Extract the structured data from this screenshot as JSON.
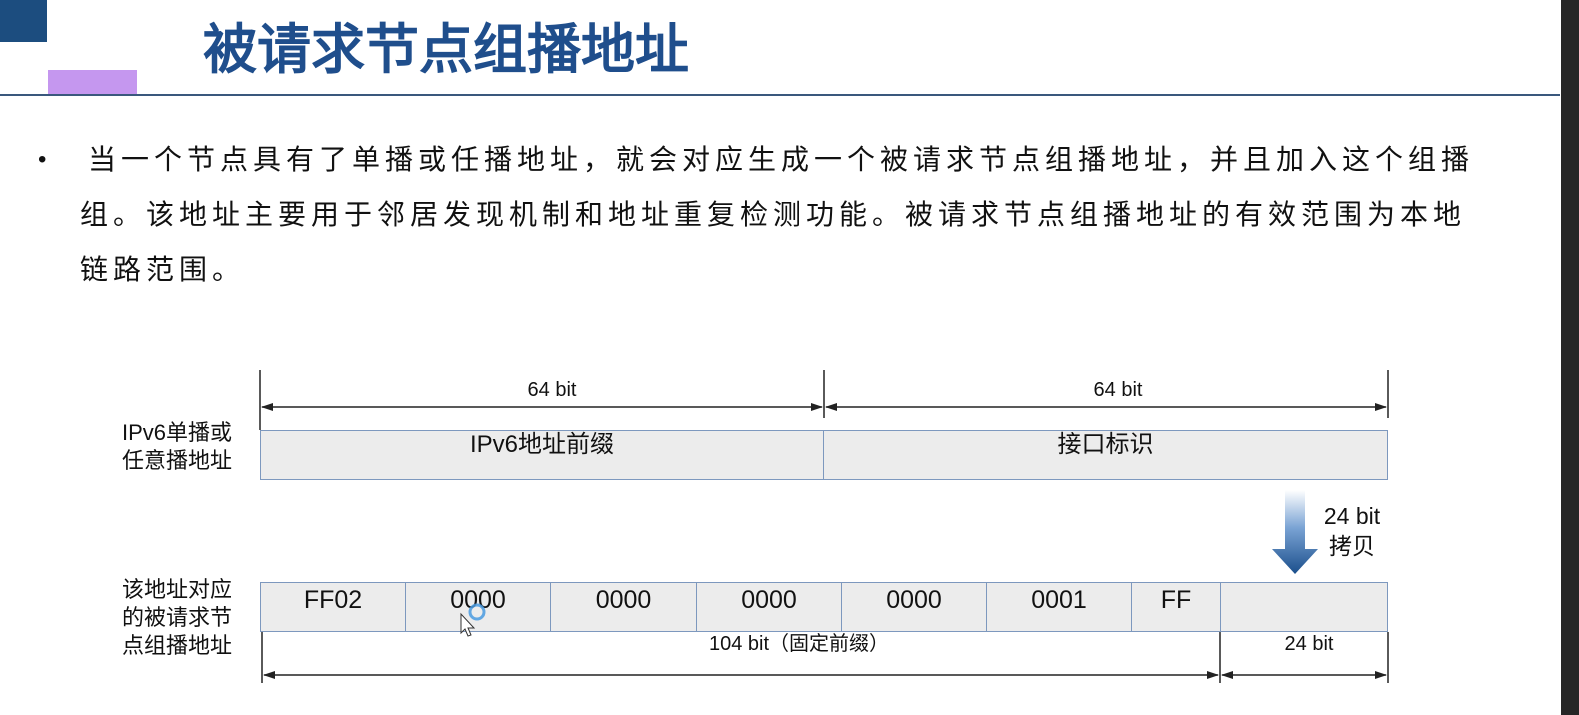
{
  "colors": {
    "title_text": "#1f4e8c",
    "corner_square": "#1c4d7f",
    "accent_bar": "#c597ef",
    "header_rule": "#3a587d",
    "body_text": "#111111",
    "cell_fill": "#ececec",
    "cell_border": "#7d98be",
    "copy_arrow": "#1b4f8c"
  },
  "slide": {
    "title": "被请求节点组播地址",
    "bullet": {
      "symbol": "•",
      "lines": [
        "当一个节点具有了单播或任播地址，就会对应生成一个被请求节点组播地址，并且加入这个组播",
        "组。该地址主要用于邻居发现机制和地址重复检测功能。被请求节点组播地址的有效范围为本地",
        "链路范围。"
      ]
    }
  },
  "diagram": {
    "top_dimensions": {
      "prefix": "64 bit",
      "interface_id": "64 bit"
    },
    "unicast_row": {
      "label_lines": [
        "IPv6单播或",
        "任意播地址"
      ],
      "fields": [
        "IPv6地址前缀",
        "接口标识"
      ]
    },
    "copy_step": {
      "bits": "24 bit",
      "action": "拷贝"
    },
    "solicited_row": {
      "label_lines": [
        "该地址对应",
        "的被请求节",
        "点组播地址"
      ],
      "fields": [
        "FF02",
        "0000",
        "0000",
        "0000",
        "0000",
        "0001",
        "FF"
      ]
    },
    "bottom_dimensions": {
      "fixed_prefix": "104 bit（固定前缀）",
      "copied_bits": "24 bit"
    }
  },
  "icons": {
    "copy_arrow": "down-arrow-icon",
    "cursor": "mouse-pointer-busy-icon"
  }
}
